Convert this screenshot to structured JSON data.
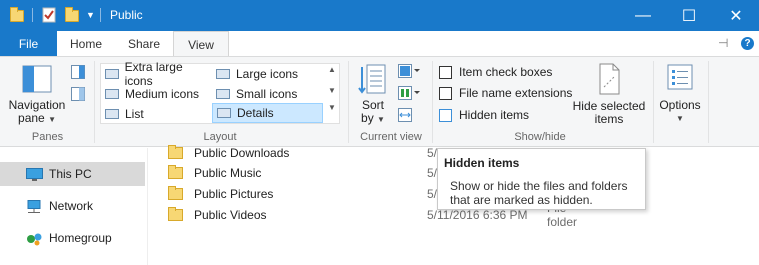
{
  "window": {
    "title": "Public",
    "minimize_glyph": "—",
    "maximize_glyph": "☐",
    "close_glyph": "✕",
    "accent_color": "#1979ca"
  },
  "tabs": {
    "file": "File",
    "home": "Home",
    "share": "Share",
    "view": "View",
    "pin_glyph": "⊣",
    "expand_glyph": "⌄",
    "help_glyph": "?"
  },
  "ribbon": {
    "panes": {
      "navigation_pane": "Navigation",
      "navigation_pane_line2": "pane",
      "group_label": "Panes"
    },
    "layout": {
      "items": [
        {
          "label": "Extra large icons"
        },
        {
          "label": "Large icons"
        },
        {
          "label": "Medium icons"
        },
        {
          "label": "Small icons"
        },
        {
          "label": "List"
        },
        {
          "label": "Details"
        }
      ],
      "selected": "Details",
      "group_label": "Layout"
    },
    "current_view": {
      "sort_by": "Sort",
      "sort_by_line2": "by",
      "group_label": "Current view"
    },
    "show_hide": {
      "item_check_boxes": "Item check boxes",
      "file_name_extensions": "File name extensions",
      "hidden_items": "Hidden items",
      "hide_selected": "Hide selected",
      "hide_selected_line2": "items",
      "group_label": "Show/hide"
    },
    "options": {
      "label": "Options"
    }
  },
  "nav": {
    "items": [
      {
        "label": "This PC",
        "icon": "computer-icon",
        "selected": true
      },
      {
        "label": "Network",
        "icon": "network-icon",
        "selected": false
      },
      {
        "label": "Homegroup",
        "icon": "homegroup-icon",
        "selected": false
      }
    ]
  },
  "files": [
    {
      "name": "Public Downloads",
      "date": "5/",
      "type": ""
    },
    {
      "name": "Public Music",
      "date": "5/",
      "type": ""
    },
    {
      "name": "Public Pictures",
      "date": "5/",
      "type": ""
    },
    {
      "name": "Public Videos",
      "date": "5/11/2016 6:36 PM",
      "type": "File folder"
    }
  ],
  "tooltip": {
    "title": "Hidden items",
    "body": "Show or hide the files and folders that are marked as hidden."
  }
}
